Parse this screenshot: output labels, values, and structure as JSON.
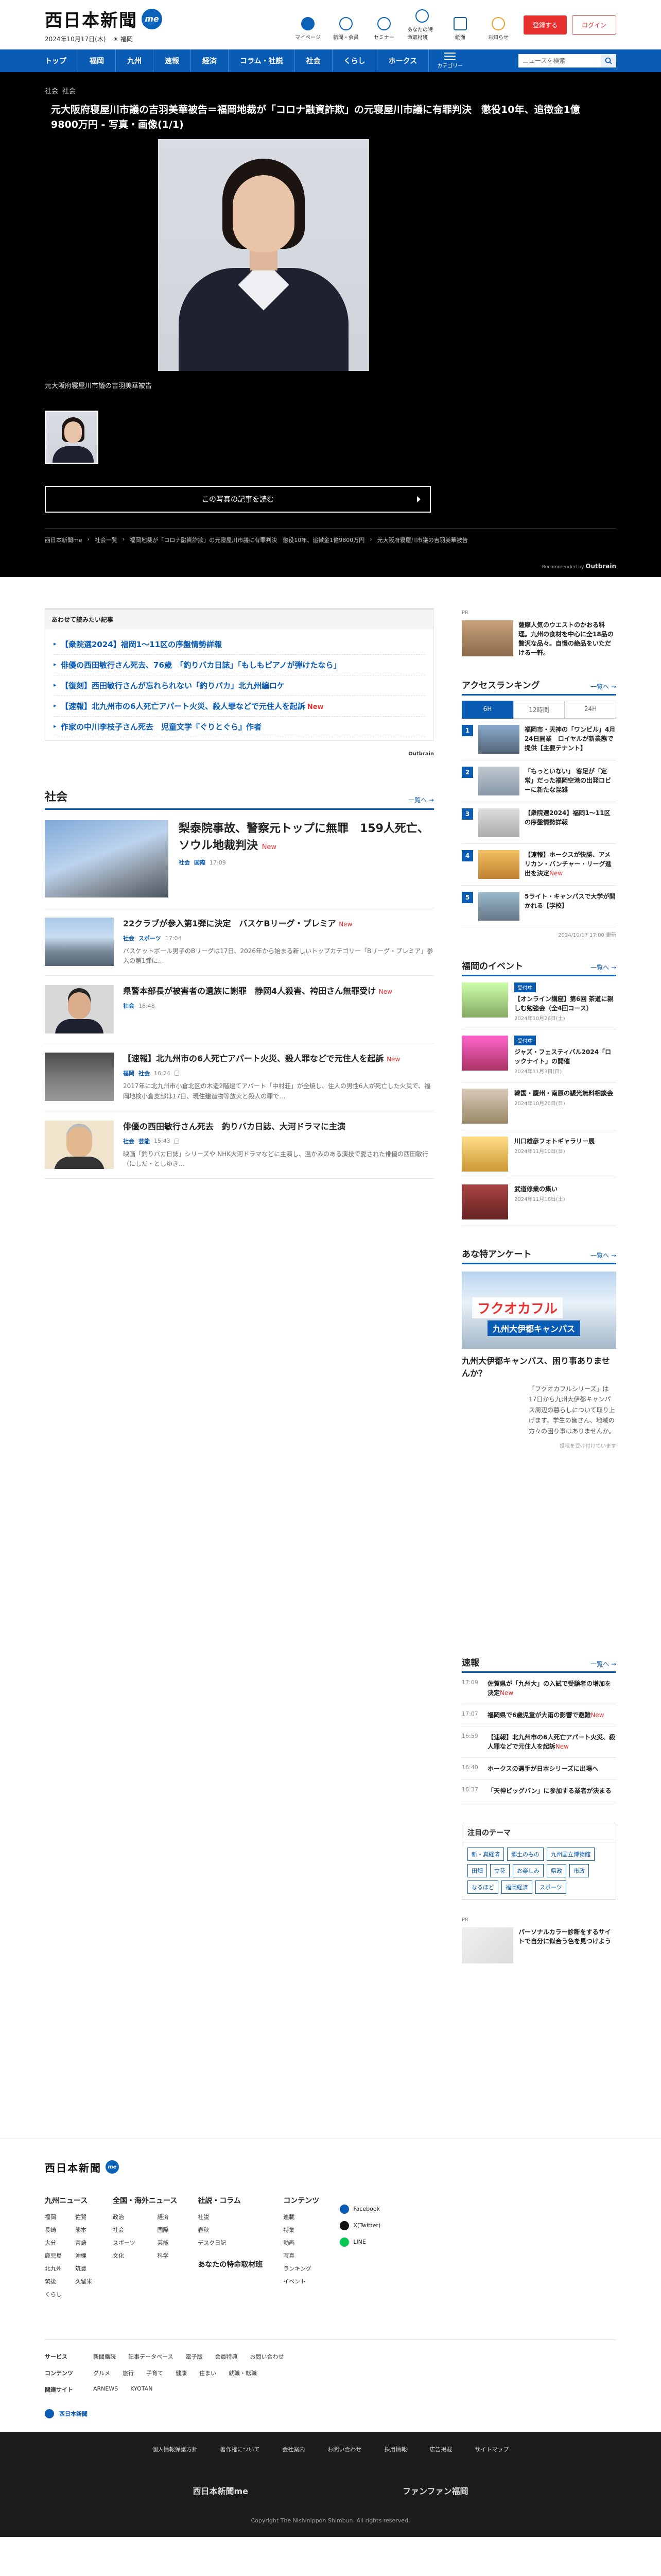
{
  "header": {
    "logo": "西日本新聞",
    "logo_badge": "me",
    "date": "2024年10月17日(木)",
    "weather": "福岡",
    "icons": [
      {
        "label": "マイページ",
        "icon": "me-icon"
      },
      {
        "label": "新聞・会員",
        "icon": "newspaper-icon"
      },
      {
        "label": "セミナー",
        "icon": "calendar-icon"
      },
      {
        "label": "あなたの特命取材班",
        "icon": "mic-icon"
      },
      {
        "label": "紙面",
        "icon": "page-icon"
      },
      {
        "label": "お知らせ",
        "icon": "bell-icon"
      }
    ],
    "register_label": "登録する",
    "login_label": "ログイン"
  },
  "nav": {
    "items": [
      "トップ",
      "福岡",
      "九州",
      "速報",
      "経済",
      "コラム・社説",
      "社会",
      "くらし",
      "ホークス"
    ],
    "menu_label": "カテゴリー",
    "search_placeholder": "ニュースを検索"
  },
  "viewer": {
    "categories": [
      "社会",
      "社会"
    ],
    "title": "元大阪府寝屋川市議の吉羽美華被告＝福岡地裁が「コロナ融資詐欺」の元寝屋川市議に有罪判決　懲役10年、追徴金1億9800万円 - 写真・画像(1/1)",
    "caption": "元大阪府寝屋川市議の吉羽美華被告",
    "read_button": "この写真の記事を読む",
    "breadcrumb": [
      "西日本新聞me",
      "社会一覧",
      "福岡地裁が「コロナ融資詐欺」の元寝屋川市議に有罪判決　懲役10年、追徴金1億9800万円",
      "元大阪府寝屋川市議の吉羽美華被告"
    ],
    "recommend": "Recommended by",
    "recommend_brand": "Outbrain"
  },
  "related": {
    "title": "あわせて読みたい記事",
    "items": [
      {
        "text": "【衆院選2024】福岡1〜11区の序盤情勢詳報",
        "new": ""
      },
      {
        "text": "俳優の西田敏行さん死去、76歳　「釣りバカ日誌」「もしもピアノが弾けたなら」",
        "new": ""
      },
      {
        "text": "【復刻】西田敏行さんが忘れられない「釣りバカ」北九州編ロケ",
        "new": ""
      },
      {
        "text": "【速報】北九州市の6人死亡アパート火災、殺人罪などで元住人を起訴",
        "new": "New"
      },
      {
        "text": "作家の中川李枝子さん死去　児童文学『ぐりとぐら』作者",
        "new": ""
      }
    ],
    "outbrain": "Outbrain"
  },
  "society": {
    "title": "社会",
    "more": "一覧へ",
    "top": {
      "title": "梨泰院事故、警察元トップに無罪　159人死亡、ソウル地裁判決",
      "new": "New",
      "cat": "社会",
      "sub": "国際",
      "time": "17:09"
    },
    "rows": [
      {
        "title": "22クラブが参入第1弾に決定　バスケBリーグ・プレミア",
        "new": "New",
        "cat": "社会",
        "sub": "スポーツ",
        "time": "17:04",
        "summary": "バスケットボール男子のBリーグは17日、2026年から始まる新しいトップカテゴリー「Bリーグ・プレミア」参入の第1弾に…",
        "img": "img-city"
      },
      {
        "title": "県警本部長が被害者の遺族に謝罪　静岡4人殺害、袴田さん無罪受け",
        "new": "New",
        "cat": "社会",
        "sub": "",
        "time": "16:48",
        "summary": "",
        "img": "img-man"
      },
      {
        "title": "【速報】北九州市の6人死亡アパート火災、殺人罪などで元住人を起訴",
        "new": "New",
        "cat": "福岡",
        "sub": "社会",
        "time": "16:24",
        "summary": "2017年に北九州市小倉北区の木造2階建てアパート「中村荘」が全焼し、住人の男性6人が死亡した火災で、福岡地検小倉支部は17日、現住建造物等放火と殺人の罪で…",
        "img": "img-fire"
      },
      {
        "title": "俳優の西田敏行さん死去　釣りバカ日誌、大河ドラマに主演",
        "new": "",
        "cat": "社会",
        "sub": "芸能",
        "time": "15:43",
        "summary": "映画「釣りバカ日誌」シリーズや NHK大河ドラマなどに主演し、温かみのある演技で愛された俳優の西田敏行（にしだ・としゆき…",
        "img": "img-old"
      }
    ]
  },
  "sidebar": {
    "ad1": {
      "label": "PR",
      "text": "薩摩人気のウエストのかおる料理。九州の食材を中心に全18品の贅沢な品々。自慢の絶品をいただける一軒。"
    },
    "ranking": {
      "title": "アクセスランキング",
      "more": "一覧へ",
      "tabs": [
        "6H",
        "12時間",
        "24H"
      ],
      "items": [
        {
          "rank": "1",
          "text": "福岡市・天神の「ワンビル」4月24日開業　ロイヤルが新業態で提供【主要テナント】",
          "new": ""
        },
        {
          "text": "「もっといない」 客足が「定常」だった福岡空港の出発ロビーに新たな混雑",
          "rank": "2",
          "new": ""
        },
        {
          "rank": "3",
          "text": "【衆院選2024】福岡1〜11区の序盤情勢詳報",
          "new": ""
        },
        {
          "rank": "4",
          "text": "【速報】ホークスが快勝、アメリカン・バンチャー・リーグ進出を決定",
          "new": "New"
        },
        {
          "rank": "5",
          "text": "5ライト・キャンパスで大学が開かれる【学校】",
          "new": ""
        }
      ],
      "note": "2024/10/17 17:00 更新"
    },
    "events": {
      "title": "福岡のイベント",
      "more": "一覧へ",
      "items": [
        {
          "tag": "受付中",
          "text": "【オンライン講座】第6回 茶道に親しむ勉強会（全4回コース）",
          "sub": "2024年10月26日(土)"
        },
        {
          "tag": "受付中",
          "text": "ジャズ・フェスティバル2024「ロックナイト」の開催",
          "sub": "2024年11月3日(日)"
        },
        {
          "tag": "",
          "text": "韓国・慶州・南原の観光無料相談会",
          "sub": "2024年10月20日(日)"
        },
        {
          "tag": "",
          "text": "川口雄彦フォトギャラリー展",
          "sub": "2024年11月10日(日)"
        },
        {
          "tag": "",
          "text": "武道修業の集い",
          "sub": "2024年11月16日(土)"
        }
      ]
    },
    "survey": {
      "title": "あな特アンケート",
      "more": "一覧へ",
      "banner1": "フクオカフル",
      "banner2": "九州大伊都キャンパス",
      "question": "九州大伊都キャンパス、困り事ありませんか？",
      "body": "「フクオカフルシリーズ」は17日から九州大伊都キャンパス周辺の暮らしについて取り上げます。学生の皆さん、地域の方々の困り事はありませんか。",
      "note": "投稿を受け付けています"
    },
    "breaking": {
      "title": "速報",
      "more": "一覧へ",
      "items": [
        {
          "time": "17:09",
          "text": "佐賀県が「九州大」の入試で受験者の増加を決定",
          "new": "New"
        },
        {
          "time": "17:07",
          "text": "福岡県で6歳児童が大雨の影響で避難",
          "new": "New"
        },
        {
          "time": "16:59",
          "text": "【速報】北九州市の6人死亡アパート火災、殺人罪などで元住人を起訴",
          "new": "New"
        },
        {
          "time": "16:40",
          "text": "ホークスの選手が日本シリーズに出場へ",
          "new": ""
        },
        {
          "time": "16:37",
          "text": "「天神ビッグバン」に参加する業者が決まる",
          "new": ""
        }
      ]
    },
    "themes": {
      "title": "注目のテーマ",
      "tags": [
        "新・真経済",
        "郷土のもの",
        "九州国立博物館",
        "田畑",
        "立花",
        "お楽しみ",
        "県政",
        "市政",
        "なるほど",
        "福岡経済",
        "スポーツ"
      ]
    },
    "ad2": {
      "label": "PR",
      "text": "パーソナルカラー診断をするサイトで自分に似合う色を見つけよう"
    }
  },
  "footer": {
    "logo": "西日本新聞",
    "cols": [
      {
        "title": "九州ニュース",
        "items": [
          "福岡",
          "佐賀",
          "長崎",
          "熊本",
          "大分",
          "宮崎",
          "鹿児島",
          "沖縄",
          "北九州",
          "筑豊",
          "筑後",
          "久留米",
          "くらし"
        ]
      },
      {
        "title": "全国・海外ニュース",
        "items": [
          "政治",
          "経済",
          "社会",
          "国際",
          "スポーツ",
          "芸能",
          "文化",
          "科学"
        ]
      },
      {
        "title": "社説・コラム",
        "items": [
          "社説",
          "春秋",
          "デスク日記"
        ]
      },
      {
        "title": "コンテンツ",
        "items": [
          "連載",
          "特集",
          "動画",
          "写真",
          "ランキング",
          "イベント"
        ]
      }
    ],
    "sub_title": "あなたの特命取材班",
    "social": [
      "Facebook",
      "X(Twitter)",
      "LINE"
    ],
    "link_rows": [
      {
        "label": "サービス",
        "items": [
          "新聞購読",
          "記事データベース",
          "電子版",
          "会員特典",
          "お問い合わせ"
        ]
      },
      {
        "label": "コンテンツ",
        "items": [
          "グルメ",
          "旅行",
          "子育て",
          "健康",
          "住まい",
          "就職・転職"
        ]
      },
      {
        "label": "関連サイト",
        "items": [
          "ARNEWS",
          "KYOTAN"
        ]
      }
    ],
    "group": "西日本新聞",
    "bottom_links": [
      "個人情報保護方針",
      "著作権について",
      "会社案内",
      "お問い合わせ",
      "採用情報",
      "広告掲載",
      "サイトマップ"
    ],
    "bottom_brand1": "西日本新聞me",
    "bottom_brand2": "ファンファン福岡",
    "copyright": "Copyright The Nishinippon Shimbun. All rights reserved."
  }
}
